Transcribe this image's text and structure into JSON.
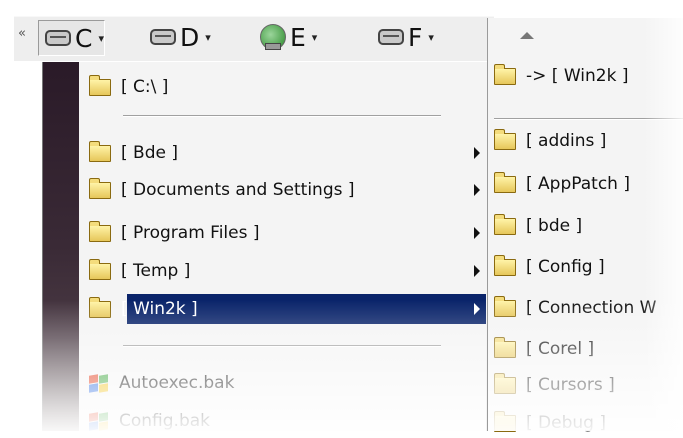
{
  "toolbar": {
    "collapse_glyph": "«",
    "drives": [
      {
        "letter": "C",
        "icon": "hard-drive-icon",
        "active": true
      },
      {
        "letter": "D",
        "icon": "hard-drive-icon",
        "active": false
      },
      {
        "letter": "E",
        "icon": "network-drive-icon",
        "active": false
      },
      {
        "letter": "F",
        "icon": "hard-drive-icon",
        "active": false
      }
    ],
    "caret": "▾"
  },
  "menu": {
    "root": "[ C:\\ ]",
    "items": [
      {
        "label": "[ Bde ]",
        "submenu": true,
        "selected": false
      },
      {
        "label": "[ Documents and Settings ]",
        "submenu": true,
        "selected": false
      },
      {
        "label": "[ Program Files ]",
        "submenu": true,
        "selected": false
      },
      {
        "label": "[ Temp ]",
        "submenu": true,
        "selected": false
      },
      {
        "label": "[ Win2k ]",
        "submenu": true,
        "selected": true
      }
    ],
    "files": [
      {
        "label": "Autoexec.bak",
        "icon": "windows-file-icon"
      },
      {
        "label": "Config.bak",
        "icon": "windows-file-icon"
      }
    ],
    "selection_color": "#0a246a"
  },
  "submenu": {
    "parent_link": "-> [ Win2k ]",
    "items": [
      "[ addins ]",
      "[ AppPatch ]",
      "[ bde ]",
      "[ Config ]",
      "[ Connection W",
      "[ Corel ]",
      "[ Cursors ]",
      "[ Debug ]"
    ]
  }
}
